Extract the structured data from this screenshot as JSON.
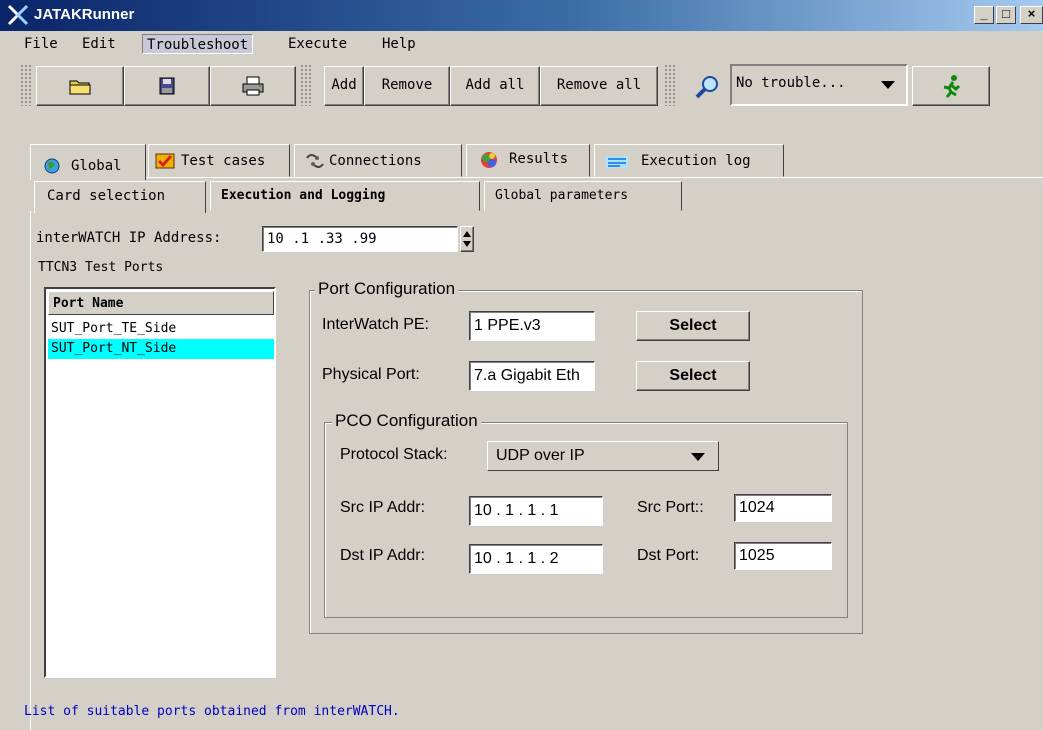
{
  "window": {
    "title": "JATAKRunner"
  },
  "menu": [
    "File",
    "Edit",
    "Troubleshoot",
    "Execute",
    "Help"
  ],
  "toolbar": {
    "icons": [
      "open-folder-icon",
      "save-disk-icon",
      "print-icon"
    ],
    "add": "Add",
    "remove": "Remove",
    "add_all": "Add all",
    "remove_all": "Remove all",
    "trouble_combo": "No trouble...",
    "run_icon": "running-man-icon"
  },
  "tabs": {
    "main": [
      "Global",
      "Test cases",
      "Connections",
      "Results",
      "Execution log"
    ],
    "sub": [
      "Card selection",
      "Execution and Logging",
      "Global parameters"
    ]
  },
  "global": {
    "ip_label": "interWATCH IP Address:",
    "ip_value": "10 .1  .33 .99",
    "ports_title": "TTCN3 Test Ports",
    "list_header": "Port Name",
    "ports": [
      "SUT_Port_TE_Side",
      "SUT_Port_NT_Side"
    ],
    "selected_port": "SUT_Port_NT_Side"
  },
  "port_config": {
    "legend": "Port Configuration",
    "pe_label": "InterWatch PE:",
    "pe_value": "1 PPE.v3",
    "select_label": "Select",
    "phys_label": "Physical Port:",
    "phys_value": "7.a Gigabit Eth"
  },
  "pco_config": {
    "legend": "PCO Configuration",
    "stack_label": "Protocol Stack:",
    "stack_value": "UDP over IP",
    "src_ip_label": "Src IP Addr:",
    "src_ip_value": "10 . 1 . 1 . 1",
    "src_port_label": "Src Port::",
    "src_port_value": "1024",
    "dst_ip_label": "Dst IP Addr:",
    "dst_ip_value": "10 . 1 . 1 . 2",
    "dst_port_label": "Dst Port:",
    "dst_port_value": "1025"
  },
  "status": "List of suitable ports obtained from interWATCH.",
  "colors": {
    "selection": "#00ffff",
    "status_text": "#0000c0",
    "title_start": "#0a246a",
    "title_end": "#a6caf0"
  }
}
